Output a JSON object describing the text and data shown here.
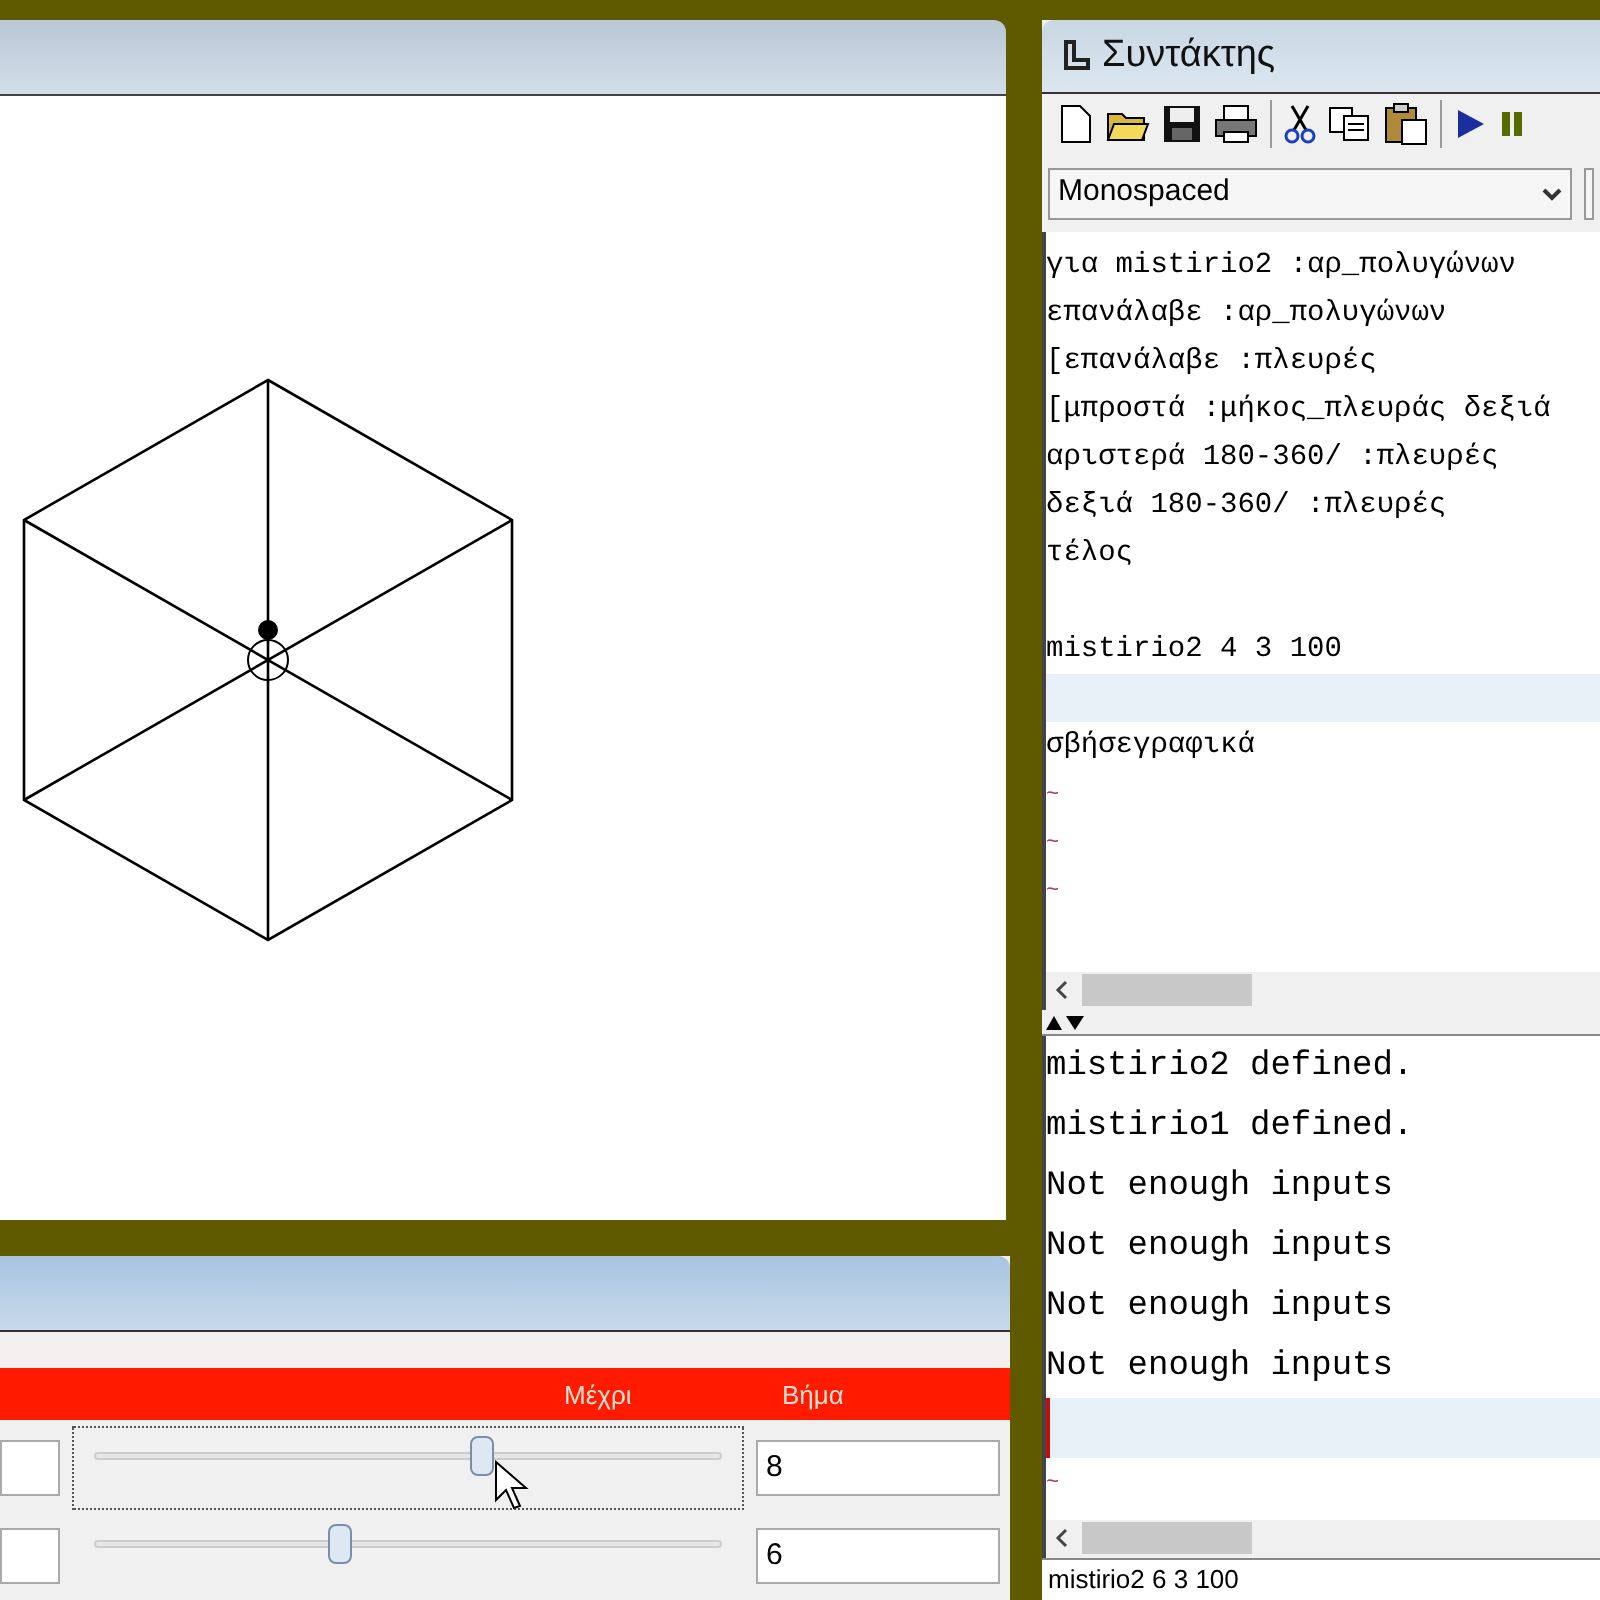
{
  "canvas_window": {
    "turtle_visible": true
  },
  "slider_window": {
    "header": [
      "Μέχρι",
      "Βήμα"
    ],
    "rows": [
      {
        "value_text": "8",
        "level": 0.62,
        "focused": true
      },
      {
        "value_text": "6",
        "level": 0.39,
        "focused": false
      }
    ]
  },
  "editor": {
    "title": "Συντάκτης",
    "toolbar": [
      {
        "kind": "new"
      },
      {
        "kind": "open"
      },
      {
        "kind": "save"
      },
      {
        "kind": "print"
      },
      {
        "kind": "sep"
      },
      {
        "kind": "cut"
      },
      {
        "kind": "copy"
      },
      {
        "kind": "paste"
      },
      {
        "kind": "sep"
      },
      {
        "kind": "run"
      },
      {
        "kind": "pause"
      }
    ],
    "font": "Monospaced",
    "code_lines": [
      {
        "kind": "text",
        "text": "για mistirio2 :αρ_πολυγώνων"
      },
      {
        "kind": "text",
        "text": "επανάλαβε :αρ_πολυγώνων"
      },
      {
        "kind": "text",
        "text": "[επανάλαβε :πλευρές"
      },
      {
        "kind": "text",
        "text": "[μπροστά :μήκος_πλευράς δεξιά"
      },
      {
        "kind": "text",
        "text": "αριστερά 180-360/ :πλευρές"
      },
      {
        "kind": "text",
        "text": "δεξιά 180-360/ :πλευρές"
      },
      {
        "kind": "text",
        "text": "τέλος"
      },
      {
        "kind": "blank"
      },
      {
        "kind": "text",
        "text": "mistirio2 4 3 100"
      },
      {
        "kind": "cursor"
      },
      {
        "kind": "text",
        "text": "σβήσεγραφικά"
      }
    ],
    "code_tildes": [
      "~",
      "~",
      "~"
    ],
    "output_lines": [
      {
        "kind": "text",
        "text": "mistirio2 defined."
      },
      {
        "kind": "text",
        "text": "mistirio1 defined."
      },
      {
        "kind": "text",
        "text": "Not enough inputs"
      },
      {
        "kind": "text",
        "text": "Not enough inputs"
      },
      {
        "kind": "text",
        "text": "Not enough inputs"
      },
      {
        "kind": "text",
        "text": "Not enough inputs"
      },
      {
        "kind": "cursor"
      }
    ],
    "output_tildes": [
      "~"
    ],
    "command": "mistirio2 6 3 100"
  }
}
